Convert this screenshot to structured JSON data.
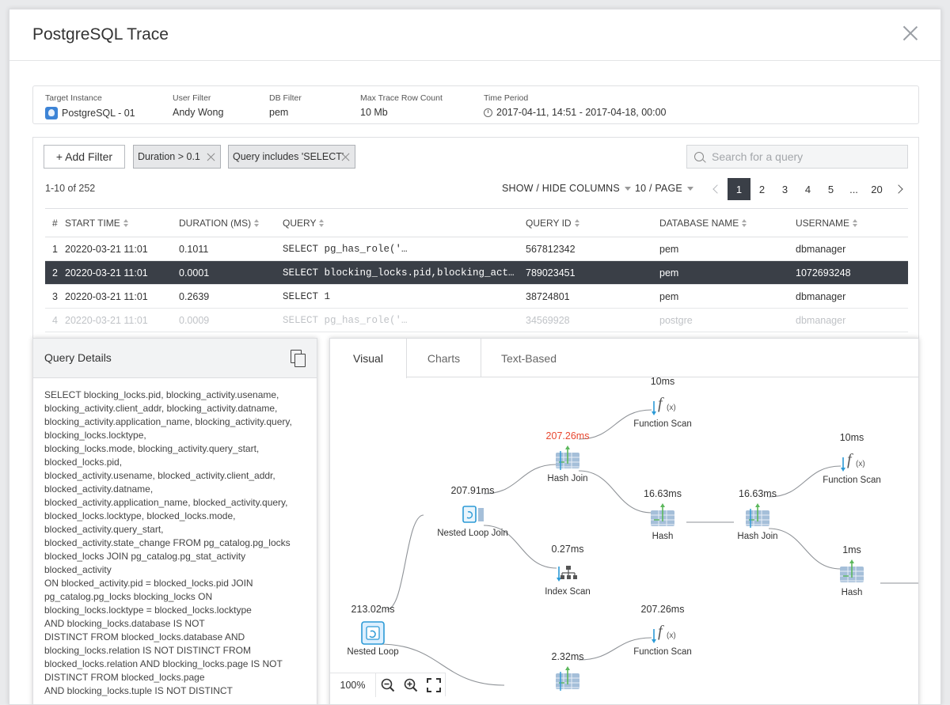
{
  "window": {
    "title": "PostgreSQL Trace"
  },
  "info": {
    "target_instance": {
      "label": "Target Instance",
      "value": "PostgreSQL - 01"
    },
    "user_filter": {
      "label": "User Filter",
      "value": "Andy Wong"
    },
    "db_filter": {
      "label": "DB Filter",
      "value": "pem"
    },
    "max_trace": {
      "label": "Max Trace Row Count",
      "value": "10 Mb"
    },
    "time_period": {
      "label": "Time Period",
      "value": "2017-04-11, 14:51 - 2017-04-18, 00:00"
    }
  },
  "filters": {
    "add_label": "+ Add Filter",
    "chips": [
      "Duration > 0.1",
      "Query includes 'SELECT'"
    ],
    "search_placeholder": "Search for a query"
  },
  "list": {
    "count_text": "1-10 of 252",
    "show_hide": "SHOW / HIDE COLUMNS",
    "per_page": "10 / PAGE",
    "pages": [
      "1",
      "2",
      "3",
      "4",
      "5",
      "...",
      "20"
    ],
    "active_page": "1",
    "columns": [
      "#",
      "START TIME",
      "DURATION (MS)",
      "QUERY",
      "QUERY ID",
      "DATABASE NAME",
      "USERNAME"
    ],
    "rows": [
      {
        "n": "1",
        "start": "20220-03-21 11:01",
        "duration": "0.1011",
        "query": "SELECT pg_has_role('…",
        "qid": "567812342",
        "db": "pem",
        "user": "dbmanager"
      },
      {
        "n": "2",
        "start": "20220-03-21 11:01",
        "duration": "0.0001",
        "query": "SELECT blocking_locks.pid,blocking_act…",
        "qid": "789023451",
        "db": "pem",
        "user": "1072693248"
      },
      {
        "n": "3",
        "start": "20220-03-21 11:01",
        "duration": "0.2639",
        "query": "SELECT 1",
        "qid": "38724801",
        "db": "pem",
        "user": "dbmanager"
      },
      {
        "n": "4",
        "start": "20220-03-21 11:01",
        "duration": "0.0009",
        "query": "SELECT pg_has_role('…",
        "qid": "34569928",
        "db": "postgre",
        "user": "dbmanager"
      }
    ],
    "selected_row": 1
  },
  "details": {
    "title": "Query Details",
    "lines": [
      "SELECT blocking_locks.pid, blocking_activity.usename,",
      "blocking_activity.client_addr, blocking_activity.datname,",
      "blocking_activity.application_name, blocking_activity.query,",
      "blocking_locks.locktype,",
      "blocking_locks.mode, blocking_activity.query_start,",
      "blocked_locks.pid,",
      "blocked_activity.usename, blocked_activity.client_addr,",
      "blocked_activity.datname,",
      "blocked_activity.application_name, blocked_activity.query,",
      "blocked_locks.locktype, blocked_locks.mode,",
      "blocked_activity.query_start,",
      "blocked_activity.state_change FROM pg_catalog.pg_locks",
      "blocked_locks JOIN pg_catalog.pg_stat_activity",
      "blocked_activity",
      "ON blocked_activity.pid = blocked_locks.pid JOIN",
      "pg_catalog.pg_locks blocking_locks ON",
      "blocking_locks.locktype = blocked_locks.locktype",
      "AND blocking_locks.database IS NOT",
      "DISTINCT FROM blocked_locks.database AND",
      "blocking_locks.relation IS NOT DISTINCT FROM",
      "blocked_locks.relation AND blocking_locks.page IS NOT",
      "DISTINCT FROM blocked_locks.page",
      "AND blocking_locks.tuple IS NOT DISTINCT"
    ]
  },
  "visual": {
    "tabs": [
      "Visual",
      "Charts",
      "Text-Based"
    ],
    "active_tab": "Visual",
    "zoom": "100%",
    "accent": "#e8472f",
    "nodes": [
      {
        "label": "Nested Loop",
        "time": "213.02ms",
        "icon": "nested-loop"
      },
      {
        "label": "Nested Loop Join",
        "time": "207.91ms",
        "icon": "nested-loop-join"
      },
      {
        "label": "Hash Join",
        "time": "207.26ms",
        "icon": "hash-join",
        "hot": true
      },
      {
        "label": "Function Scan",
        "time": "10ms",
        "icon": "function-scan"
      },
      {
        "label": "Hash",
        "time": "16.63ms",
        "icon": "hash"
      },
      {
        "label": "Hash Join",
        "time": "16.63ms",
        "icon": "hash-join"
      },
      {
        "label": "Function Scan",
        "time": "10ms",
        "icon": "function-scan"
      },
      {
        "label": "Hash",
        "time": "1ms",
        "icon": "hash"
      },
      {
        "label": "Index Scan",
        "time": "0.27ms",
        "icon": "index-scan"
      },
      {
        "label": "Function Scan",
        "time": "207.26ms",
        "icon": "function-scan"
      },
      {
        "label": "",
        "time": "2.32ms",
        "icon": "hash-join"
      }
    ]
  }
}
